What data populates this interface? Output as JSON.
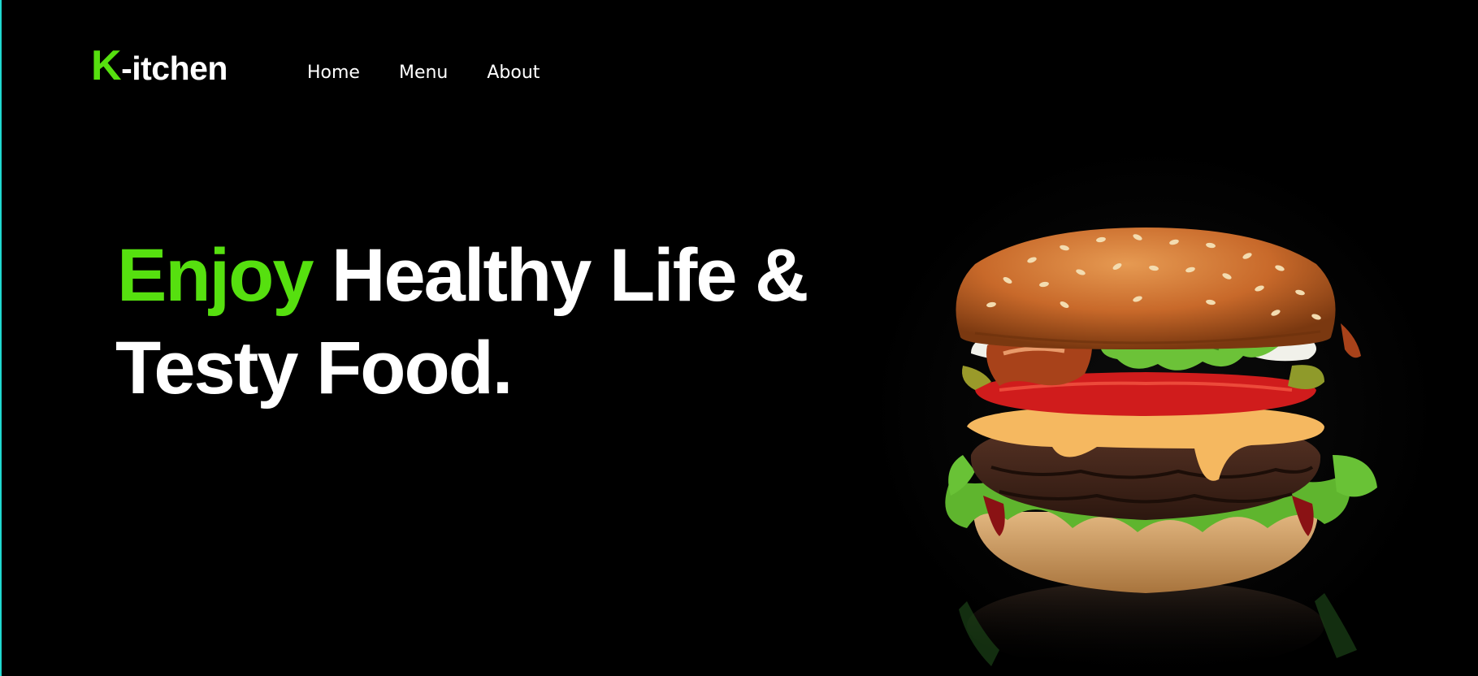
{
  "logo": {
    "first_letter": "K",
    "rest": "-itchen"
  },
  "nav": {
    "items": [
      {
        "label": "Home"
      },
      {
        "label": "Menu"
      },
      {
        "label": "About"
      }
    ]
  },
  "hero": {
    "headline_accent": "Enjoy",
    "headline_line1_rest": " Healthy Life &",
    "headline_line2": "Testy Food."
  },
  "colors": {
    "accent": "#56e00f",
    "background": "#000000",
    "text": "#ffffff",
    "edge": "#1fd8d0"
  },
  "image": {
    "subject": "burger-image"
  }
}
